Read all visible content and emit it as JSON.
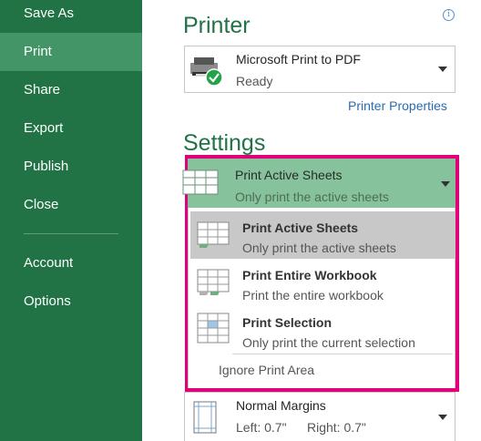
{
  "nav": {
    "items": [
      {
        "label": "Save As",
        "selected": false
      },
      {
        "label": "Print",
        "selected": true
      },
      {
        "label": "Share",
        "selected": false
      },
      {
        "label": "Export",
        "selected": false
      },
      {
        "label": "Publish",
        "selected": false
      },
      {
        "label": "Close",
        "selected": false
      },
      {
        "label": "Account",
        "selected": false
      },
      {
        "label": "Options",
        "selected": false
      }
    ]
  },
  "printer": {
    "title": "Printer",
    "info_icon": "i",
    "name": "Microsoft Print to PDF",
    "status": "Ready",
    "properties_link": "Printer Properties"
  },
  "settings": {
    "title": "Settings",
    "selected": {
      "title": "Print Active Sheets",
      "desc": "Only print the active sheets"
    },
    "options": [
      {
        "title": "Print Active Sheets",
        "desc": "Only print the active sheets",
        "icon": "active-sheets-icon"
      },
      {
        "title": "Print Entire Workbook",
        "desc": "Print the entire workbook",
        "icon": "workbook-icon"
      },
      {
        "title": "Print Selection",
        "desc": "Only print the current selection",
        "icon": "selection-icon"
      }
    ],
    "ignore_print_area": "Ignore Print Area",
    "margins": {
      "title": "Normal Margins",
      "left": "Left:  0.7\"",
      "right": "Right:  0.7\""
    }
  },
  "colors": {
    "nav_bg": "#217346",
    "nav_selected": "#439467",
    "accent": "#217346",
    "highlight": "#e0007a",
    "dropdown_selected": "#86c29b"
  }
}
